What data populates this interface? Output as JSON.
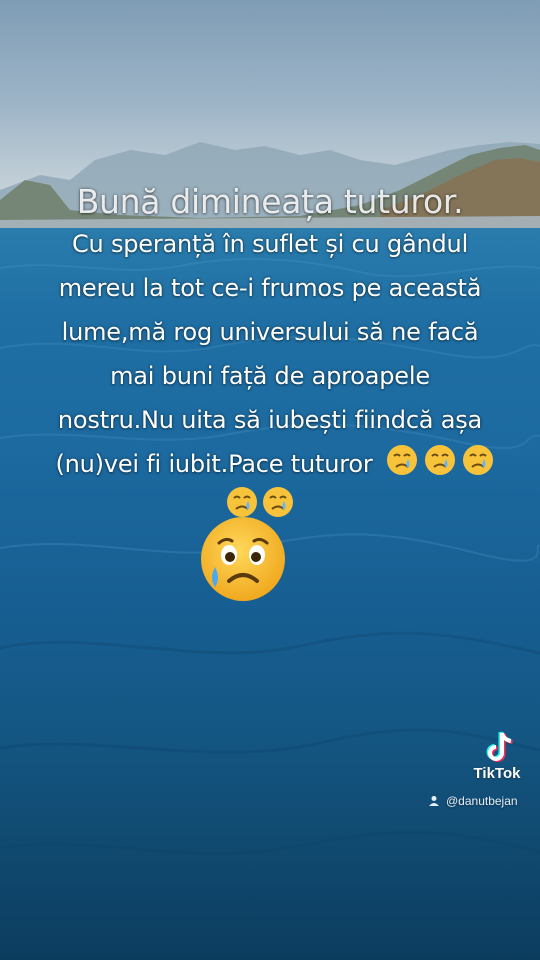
{
  "overlay": {
    "title": "Bună dimineața tuturor.",
    "lines": [
      "Cu speranță în suflet și cu gândul",
      "mereu la tot ce-i frumos pe această",
      "lume,mă rog universului să ne facă",
      "mai buni față de aproapele",
      "nostru.Nu uita să iubești fiindcă așa",
      "(nu)vei fi iubit.Pace tuturor"
    ],
    "emoji_names": [
      "crying-face-icon",
      "crying-face-icon",
      "crying-face-icon",
      "crying-face-icon",
      "crying-face-icon",
      "sad-tear-face-icon"
    ]
  },
  "watermark": {
    "brand": "TikTok",
    "handle": "@danutbejan",
    "logo_icon": "tiktok-logo-icon",
    "user_icon": "user-icon"
  },
  "colors": {
    "sea": "#1c6aa0",
    "sky": "#9db4c7",
    "text": "#ffffff",
    "emoji_yellow": "#f7c33a"
  }
}
